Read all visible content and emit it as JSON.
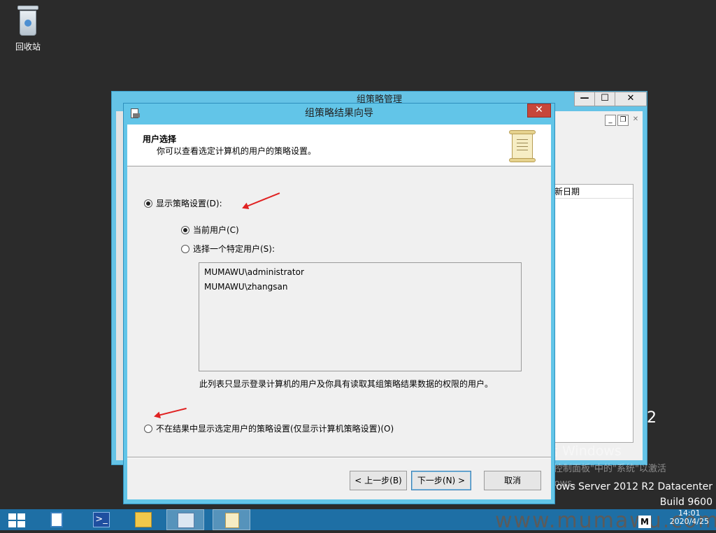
{
  "desktop": {
    "recycle_bin_label": "回收站",
    "os_edition": "Windows Server 2012 R2 Datacenter",
    "os_edition_visible": "ows Server 2012 R2 Datacenter",
    "os_build": "Build 9600",
    "activation_title": "激活 Windows",
    "activation_line1": "转到\"控制面板\"中的\"系统\"以激活",
    "activation_line2": "Windows。",
    "ghost_text": "2",
    "watermark": "www.mumawu.com"
  },
  "background_window": {
    "title": "组策略管理",
    "column_header": "新日期",
    "minimize_label": "—",
    "maximize_label": "☐",
    "close_label": "✕"
  },
  "wizard": {
    "title": "组策略结果向导",
    "close_label": "✕",
    "header_title": "用户选择",
    "header_subtitle": "你可以查看选定计算机的用户的策略设置。",
    "show_policy_label": "显示策略设置(D):",
    "current_user_label": "当前用户(C)",
    "specific_user_label": "选择一个特定用户(S):",
    "users": [
      "MUMAWU\\administrator",
      "MUMAWU\\zhangsan"
    ],
    "list_note": "此列表只显示登录计算机的用户及你具有读取其组策略结果数据的权限的用户。",
    "no_user_policy_label": "不在结果中显示选定用户的策略设置(仅显示计算机策略设置)(O)",
    "back_button": "< 上一步(B)",
    "next_button": "下一步(N) >",
    "cancel_button": "取消",
    "show_policy_selected": true,
    "current_user_selected": true
  },
  "taskbar": {
    "time": "14:01",
    "date": "2020/4/25"
  },
  "colors": {
    "title_bar": "#62c5e8",
    "close_button": "#c7463a",
    "taskbar": "#1e6fa5",
    "desktop": "#2b2b2b",
    "annotation_arrow": "#e02222"
  }
}
